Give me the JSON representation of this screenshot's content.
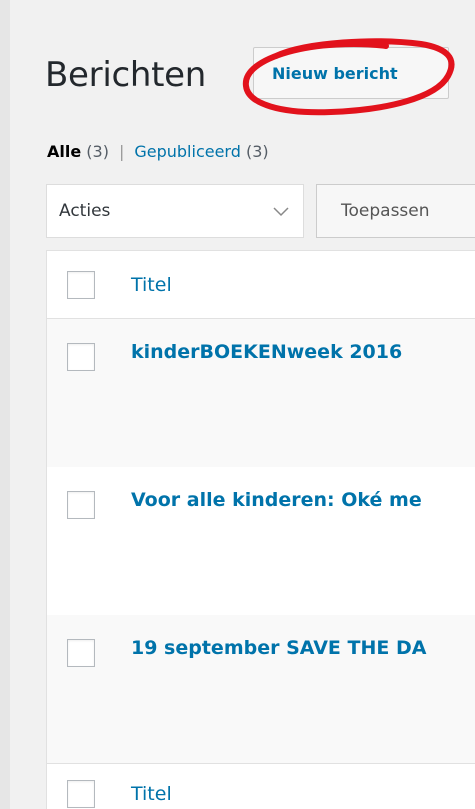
{
  "page": {
    "title": "Berichten",
    "new_button": "Nieuw bericht"
  },
  "filters": {
    "all_label": "Alle",
    "all_count": "(3)",
    "separator": "|",
    "published_label": "Gepubliceerd",
    "published_count": "(3)"
  },
  "bulk_actions": {
    "selected": "Acties",
    "apply_label": "Toepassen"
  },
  "table": {
    "header_title": "Titel",
    "footer_title": "Titel",
    "rows": [
      {
        "title": "kinderBOEKENweek 2016"
      },
      {
        "title": "Voor alle kinderen: Oké me"
      },
      {
        "title": "19 september SAVE THE DA"
      }
    ]
  },
  "colors": {
    "link": "#0073aa",
    "annotation": "#e2121c"
  }
}
